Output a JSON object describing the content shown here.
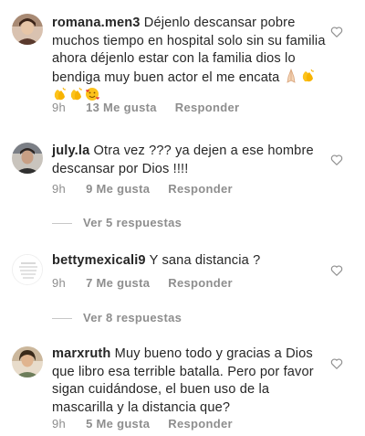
{
  "comments": [
    {
      "username": "romana.men3",
      "text": " Déjenlo descansar pobre muchos tiempo en hospital solo sin su familia ahora déjenlo estar con la familia dios lo bendiga muy buen actor el me encata ",
      "emojis": [
        "praying-hands",
        "clapping-hands",
        "clapping-hands",
        "clapping-hands",
        "smiling-face-with-hearts"
      ],
      "time": "9h",
      "likes": "13 Me gusta",
      "reply": "Responder"
    },
    {
      "username": "july.la",
      "text": " Otra vez ??? ya dejen a ese hombre descansar por Dios !!!!",
      "time": "9h",
      "likes": "9 Me gusta",
      "reply": "Responder",
      "view_replies": "Ver 5 respuestas"
    },
    {
      "username": "bettymexicali9",
      "text": " Y sana  distancia ?",
      "time": "9h",
      "likes": "7 Me gusta",
      "reply": "Responder",
      "view_replies": "Ver 8 respuestas"
    },
    {
      "username": "marxruth",
      "text": " Muy bueno todo y gracias a Dios que libro esa terrible batalla. Pero por favor sigan cuidándose, el buen uso de la mascarilla y la distancia que?",
      "time": "9h",
      "likes": "5 Me gusta",
      "reply": "Responder"
    }
  ],
  "colors": {
    "text": "#262626",
    "secondary": "#8e8e8e",
    "divider": "#c7c7c7"
  },
  "icons": {
    "like": "heart-outline-icon",
    "avatar": "user-avatar"
  }
}
